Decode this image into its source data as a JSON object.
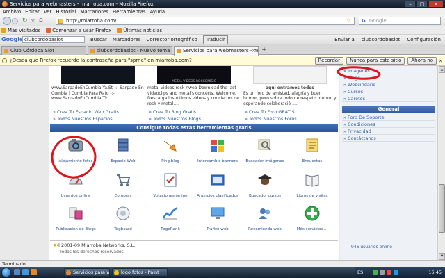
{
  "window": {
    "title": "Servicios para webmasters - miarroba.com - Mozilla Firefox"
  },
  "menubar": [
    "Archivo",
    "Editar",
    "Ver",
    "Historial",
    "Marcadores",
    "Herramientas",
    "Ayuda"
  ],
  "nav": {
    "url": "http://miarroba.com/",
    "search_placeholder": "Google",
    "search_engine": "G"
  },
  "bookmarks": [
    "Más visitados",
    "Comenzar a usar Firefox",
    "Últimas noticias"
  ],
  "google_toolbar": {
    "logo": "Google",
    "input": "clubcordobaslot",
    "items": [
      "Buscar",
      "Marcadores",
      "Corrector ortográfico"
    ],
    "traducir": "Traducir",
    "right_items": [
      "Enviar a",
      "clubcordobaslot",
      "Configuración"
    ]
  },
  "tabs": [
    {
      "label": "Club Córdoba Slot",
      "active": false
    },
    {
      "label": "clubcordobaslot - Nuevo tema",
      "active": false
    },
    {
      "label": "Servicios para webmasters - mia...",
      "active": true
    }
  ],
  "notification": {
    "text": "¿Desea que Firefox recuerde la contraseña para \"sprne\" en miarroba.com?",
    "buttons": [
      "Recordar",
      "Nunca para este sitio",
      "Ahora no"
    ]
  },
  "top_columns": [
    {
      "desc": "www.SarpadoEnCumbia.Ya.St -:- Sarpado En Cumbia | Cumbia Para Rato -:- www.SarpadoEnCumbia.Tk",
      "links": [
        "» Crea Tu Espacio Web Gratis",
        "» Todos Nuestros Espacios"
      ]
    },
    {
      "img_caption": "METAL VIDEOS ROCK&MISIC",
      "desc": "metal videos rock nweb Download the last videoclips and metal's concerts. Welcome. Descarga los últimos videos y conciertos de rock y metal....",
      "links": [
        "» Crea Tu Blog Gratis",
        "» Todos Nuestros Blogs"
      ]
    },
    {
      "title": "aqui entramos todos",
      "desc": "Es un foro de amistad, alegría y buen humor, pero sobre todo de respeto mutuo, y esperando colaboració ....",
      "links": [
        "» Crea Tu Foro GRATIS",
        "» Todos Nuestros Foros"
      ]
    }
  ],
  "tools_header": "Consigue todas estas herramientas gratis",
  "tools": [
    [
      "Alojamiento fotos",
      "Espacio Web",
      "Ping blog",
      "Intercambio banners",
      "Buscador imágenes",
      "Encuestas"
    ],
    [
      "Usuarios online",
      "Compras",
      "Votaciones online",
      "Anuncios clasificados",
      "Buscador cursos",
      "Libros de visitas"
    ],
    [
      "Publicación de Blogs",
      "Tagboard",
      "PageRank",
      "Tráfico web",
      "Recomienda web",
      "Más servicios ..."
    ]
  ],
  "footer": {
    "copyright": "©2001-09 Miarroba Networks, S.L.",
    "rights": "Todos los derechos reservados"
  },
  "sidebar": {
    "items_top": [
      "» Imágenes",
      "» Blogs",
      "» Webcindario",
      "» Cursos",
      "» Caretos"
    ],
    "general_title": "General",
    "items_general": [
      "» Foro De Soporte",
      "» Condiciones",
      "» Privacidad",
      "» Contáctanos"
    ],
    "online": "946 usuarios online"
  },
  "status": "Terminado",
  "taskbar": {
    "buttons": [
      "Servicios para web...",
      "logo fotos - Paint"
    ],
    "lang": "ES",
    "clock": "16:45"
  }
}
